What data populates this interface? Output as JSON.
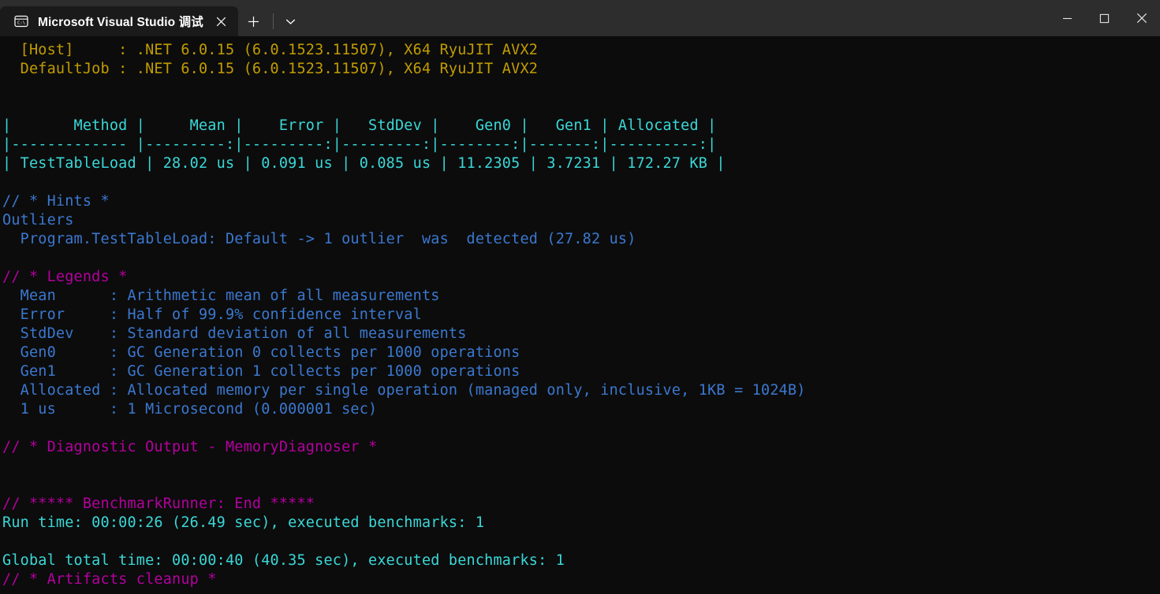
{
  "window": {
    "tab": {
      "title": "Microsoft Visual Studio 调试",
      "icon": "command-prompt-icon",
      "close_label": "✕"
    },
    "new_tab_label": "+",
    "dropdown_label": "⌄",
    "controls": {
      "minimize_label": "—",
      "maximize_label": "□",
      "close_label": "✕"
    }
  },
  "colors": {
    "titlebar_bg": "#2d2d2d",
    "tab_bg": "#1a1a1a",
    "terminal_bg": "#0c0c0c",
    "yellow": "#c19c00",
    "cyan": "#3ad7d7",
    "blue": "#3b78cf",
    "magenta": "#b4009e"
  },
  "terminal": {
    "lines": [
      {
        "text": "  [Host]     : .NET 6.0.15 (6.0.1523.11507), X64 RyuJIT AVX2",
        "color": "yellow"
      },
      {
        "text": "  DefaultJob : .NET 6.0.15 (6.0.1523.11507), X64 RyuJIT AVX2",
        "color": "yellow"
      },
      {
        "text": "",
        "color": "white"
      },
      {
        "text": "",
        "color": "white"
      },
      {
        "text": "|       Method |     Mean |    Error |   StdDev |    Gen0 |   Gen1 | Allocated |",
        "color": "cyan"
      },
      {
        "text": "|------------- |---------:|---------:|---------:|--------:|-------:|----------:|",
        "color": "cyan"
      },
      {
        "text": "| TestTableLoad | 28.02 us | 0.091 us | 0.085 us | 11.2305 | 3.7231 | 172.27 KB |",
        "color": "cyan"
      },
      {
        "text": "",
        "color": "white"
      },
      {
        "text": "// * Hints *",
        "color": "blue"
      },
      {
        "text": "Outliers",
        "color": "blue"
      },
      {
        "text": "  Program.TestTableLoad: Default -> 1 outlier  was  detected (27.82 us)",
        "color": "blue"
      },
      {
        "text": "",
        "color": "white"
      },
      {
        "text": "// * Legends *",
        "color": "magenta"
      },
      {
        "text": "  Mean      : Arithmetic mean of all measurements",
        "color": "blue"
      },
      {
        "text": "  Error     : Half of 99.9% confidence interval",
        "color": "blue"
      },
      {
        "text": "  StdDev    : Standard deviation of all measurements",
        "color": "blue"
      },
      {
        "text": "  Gen0      : GC Generation 0 collects per 1000 operations",
        "color": "blue"
      },
      {
        "text": "  Gen1      : GC Generation 1 collects per 1000 operations",
        "color": "blue"
      },
      {
        "text": "  Allocated : Allocated memory per single operation (managed only, inclusive, 1KB = 1024B)",
        "color": "blue"
      },
      {
        "text": "  1 us      : 1 Microsecond (0.000001 sec)",
        "color": "blue"
      },
      {
        "text": "",
        "color": "white"
      },
      {
        "text": "// * Diagnostic Output - MemoryDiagnoser *",
        "color": "magenta"
      },
      {
        "text": "",
        "color": "white"
      },
      {
        "text": "",
        "color": "white"
      },
      {
        "text": "// ***** BenchmarkRunner: End *****",
        "color": "magenta"
      },
      {
        "text": "Run time: 00:00:26 (26.49 sec), executed benchmarks: 1",
        "color": "cyan"
      },
      {
        "text": "",
        "color": "white"
      },
      {
        "text": "Global total time: 00:00:40 (40.35 sec), executed benchmarks: 1",
        "color": "cyan"
      },
      {
        "text": "// * Artifacts cleanup *",
        "color": "magenta"
      }
    ]
  }
}
